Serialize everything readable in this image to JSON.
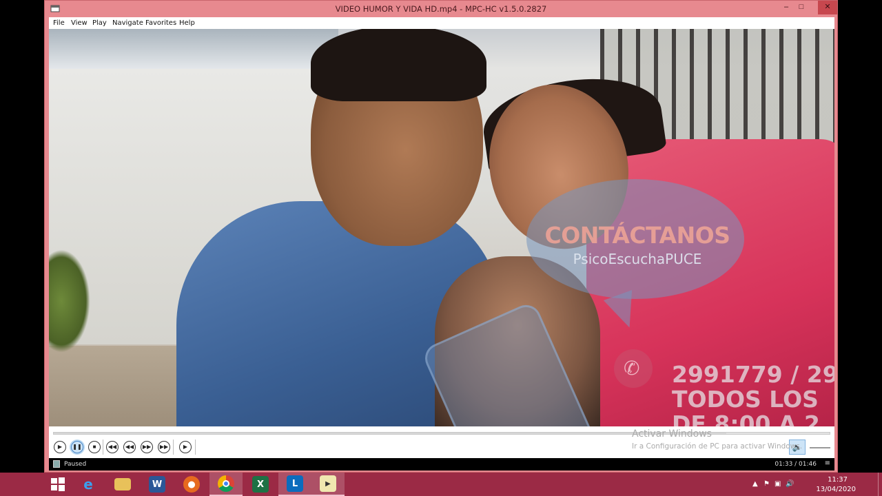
{
  "window": {
    "title": "VIDEO HUMOR Y VIDA HD.mp4 - MPC-HC v1.5.0.2827",
    "minimize": "–",
    "maximize": "□",
    "close": "✕"
  },
  "menu": [
    "File",
    "View",
    "Play",
    "Navigate",
    "Favorites",
    "Help"
  ],
  "video_overlay": {
    "bubble_title": "CONTÁCTANOS",
    "bubble_subtitle": "PsicoEscuchaPUCE",
    "phone_line": "2991779 / 29",
    "hours_line": "TODOS LOS",
    "time_line": "DE 8:00 A 2"
  },
  "controls": {
    "buttons": [
      {
        "name": "play-button",
        "glyph": "▶"
      },
      {
        "name": "pause-button",
        "glyph": "❚❚"
      },
      {
        "name": "stop-button",
        "glyph": "■"
      },
      {
        "name": "previous-button",
        "glyph": "⏮"
      },
      {
        "name": "rewind-button",
        "glyph": "⏪"
      },
      {
        "name": "fast-forward-button",
        "glyph": "⏩"
      },
      {
        "name": "next-button",
        "glyph": "⏭"
      },
      {
        "name": "frame-step-button",
        "glyph": "⏯"
      }
    ],
    "selected": "pause-button",
    "seek_progress": 0.867,
    "volume_icon": "speaker-muted-icon"
  },
  "activation_watermark": {
    "title": "Activar Windows",
    "subtitle": "Ir a Configuración de PC para activar Windows."
  },
  "status": {
    "state": "Paused",
    "time": "01:33 / 01:46"
  },
  "taskbar": {
    "apps": [
      "windows-start-icon",
      "internet-explorer-icon",
      "file-explorer-icon",
      "word-icon",
      "firefox-icon",
      "chrome-icon",
      "excel-icon",
      "lync-icon",
      "mpc-hc-icon"
    ],
    "active_app": "mpc-hc-icon",
    "clock_time": "11:37",
    "clock_date": "13/04/2020"
  },
  "colors": {
    "window_frame": "#e7898f",
    "taskbar": "#9b2a45",
    "close_button": "#c7474e"
  }
}
